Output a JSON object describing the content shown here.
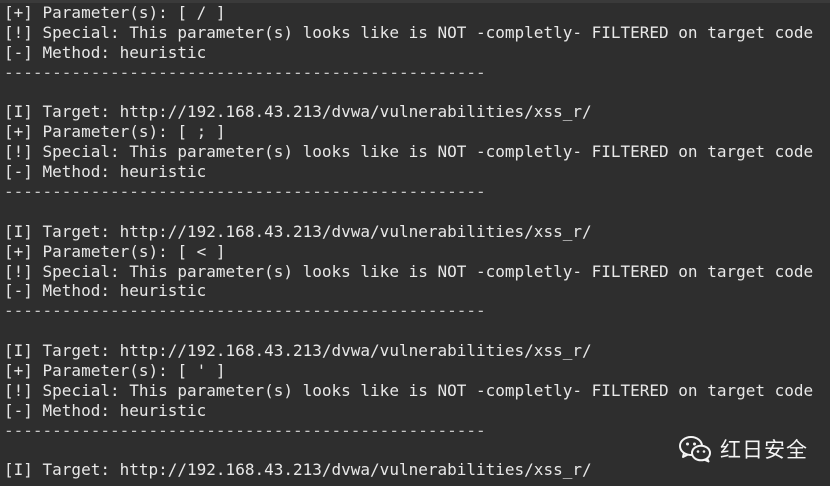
{
  "terminal": {
    "lines": [
      "[+] Parameter(s): [ / ]",
      "[!] Special: This parameter(s) looks like is NOT -completly- FILTERED on target code",
      "[-] Method: heuristic",
      "--------------------------------------------------",
      "",
      "[I] Target: http://192.168.43.213/dvwa/vulnerabilities/xss_r/",
      "[+] Parameter(s): [ ; ]",
      "[!] Special: This parameter(s) looks like is NOT -completly- FILTERED on target code",
      "[-] Method: heuristic",
      "--------------------------------------------------",
      "",
      "[I] Target: http://192.168.43.213/dvwa/vulnerabilities/xss_r/",
      "[+] Parameter(s): [ < ]",
      "[!] Special: This parameter(s) looks like is NOT -completly- FILTERED on target code",
      "[-] Method: heuristic",
      "--------------------------------------------------",
      "",
      "[I] Target: http://192.168.43.213/dvwa/vulnerabilities/xss_r/",
      "[+] Parameter(s): [ ' ]",
      "[!] Special: This parameter(s) looks like is NOT -completly- FILTERED on target code",
      "[-] Method: heuristic",
      "--------------------------------------------------",
      "",
      "[I] Target: http://192.168.43.213/dvwa/vulnerabilities/xss_r/"
    ]
  },
  "watermark": {
    "text": "红日安全",
    "icon": "wechat-icon"
  },
  "colors": {
    "background": "#2e2e2e",
    "text": "#e8e8e8"
  }
}
